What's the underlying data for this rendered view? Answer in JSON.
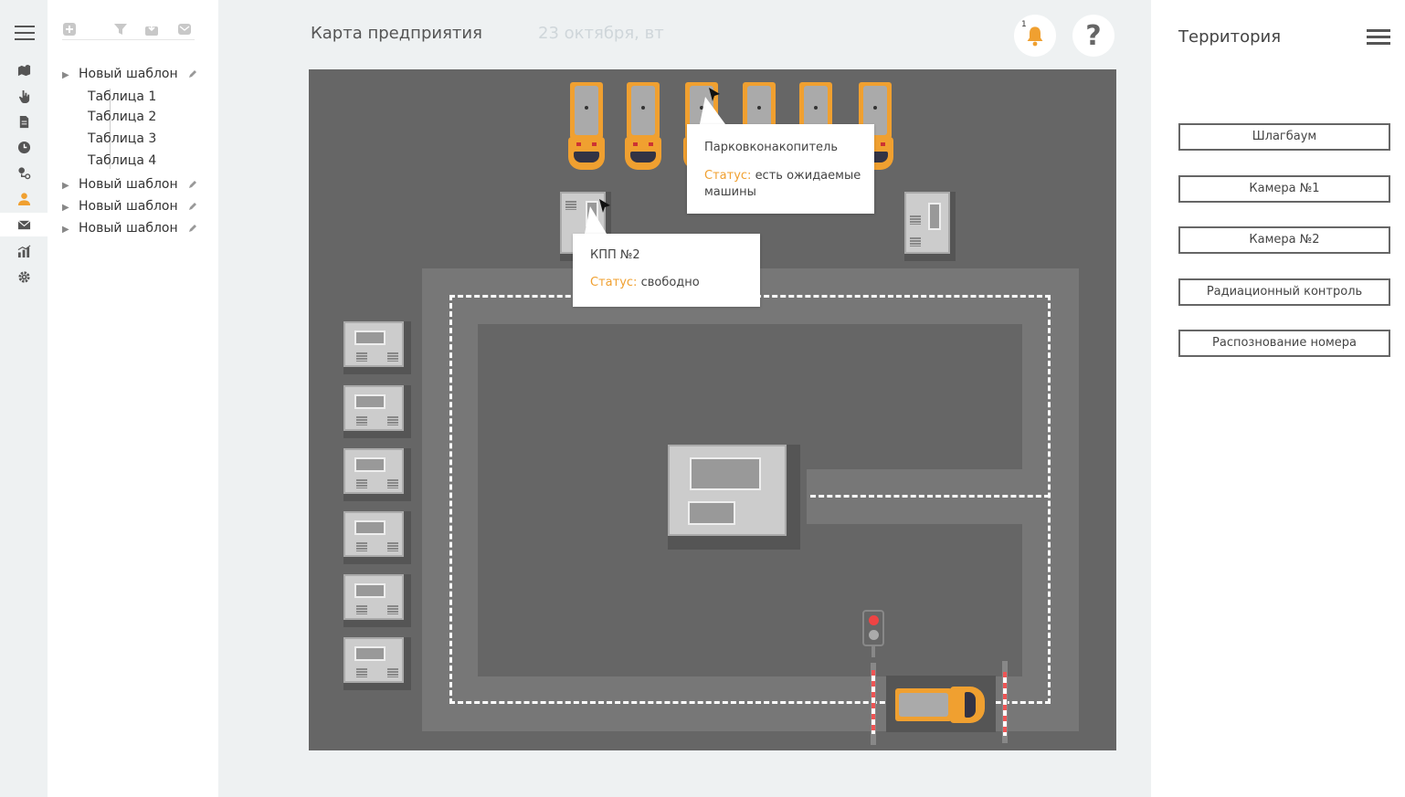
{
  "header": {
    "title": "Карта предприятия",
    "date": "23 октября, вт",
    "notifications_count": "1",
    "help_label": "?"
  },
  "tree": {
    "templates": [
      {
        "label": "Новый шаблон",
        "expanded": true,
        "children": [
          "Таблица 1",
          "Таблица 2",
          "Таблица 3",
          "Таблица 4"
        ]
      },
      {
        "label": "Новый шаблон",
        "expanded": false
      },
      {
        "label": "Новый шаблон",
        "expanded": false
      },
      {
        "label": "Новый шаблон",
        "expanded": false
      }
    ]
  },
  "map": {
    "popups": [
      {
        "title": "Парковконакопитель",
        "status_label": "Статус:",
        "status_value": "есть ожидаемые машины"
      },
      {
        "title": "КПП №2",
        "status_label": "Статус:",
        "status_value": "свободно"
      }
    ]
  },
  "right_panel": {
    "title": "Территория",
    "buttons": [
      "Шлагбаум",
      "Камера №1",
      "Камера №2",
      "Радиационный контроль",
      "Распознование номера"
    ]
  },
  "colors": {
    "accent": "#f0a030",
    "map_bg": "#666666",
    "road": "#777777"
  }
}
